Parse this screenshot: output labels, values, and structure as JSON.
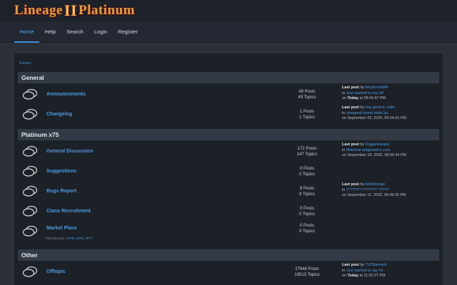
{
  "header": {
    "logo_left": "Lineage",
    "logo_mark": "II",
    "logo_right": "Platinum"
  },
  "nav": [
    "Home",
    "Help",
    "Search",
    "Login",
    "Register"
  ],
  "breadcrumb": "Forum",
  "categories": [
    {
      "title": "General",
      "boards": [
        {
          "title": "Announcements",
          "posts": "49 Posts",
          "topics": "49 Topics",
          "last_label": "Last post",
          "by": "by",
          "author": "AmyKnox884",
          "in": "in",
          "topic": "Just wanted to say Hi!",
          "on": "on",
          "date": "Today",
          "time": "at 08:42:47 PM"
        },
        {
          "title": "Changelog",
          "posts": "1 Posts",
          "topics": "1 Topics",
          "last_label": "Last post",
          "by": "by",
          "author": "buy generic cialis",
          "in": "in",
          "topic": "cheapest brand cialis 5p...",
          "on": "on",
          "date": "",
          "time": "September 02, 2020, 06:24:41 PM"
        }
      ]
    },
    {
      "title": "Platinum x75",
      "boards": [
        {
          "title": "General Discussion",
          "posts": "172 Posts",
          "topics": "147 Topics",
          "last_label": "Last post",
          "by": "by",
          "author": "Riggantsuqeq",
          "in": "in",
          "topic": "Maternal epigenetics com...",
          "on": "on",
          "date": "",
          "time": "September 18, 2020, 08:05:44 PM"
        },
        {
          "title": "Suggestions",
          "posts": "0 Posts",
          "topics": "0 Topics"
        },
        {
          "title": "Bugs Report",
          "posts": "9 Posts",
          "topics": "9 Topics",
          "last_label": "Last post",
          "by": "by",
          "author": "AdiSmonge",
          "in": "in",
          "topic": "??????? ??????? ?????",
          "on": "on",
          "date": "",
          "time": "September 11, 2020, 06:49:26 PM"
        },
        {
          "title": "Clans Recruitment",
          "posts": "0 Posts",
          "topics": "0 Topics"
        },
        {
          "title": "Market Place",
          "posts": "0 Posts",
          "topics": "0 Topics",
          "child_label": "Child Boards:",
          "children": "WTB, WTS, WTT"
        }
      ]
    },
    {
      "title": "Other",
      "boards": [
        {
          "title": "Offtopic",
          "posts": "27648 Posts",
          "topics": "19513 Topics",
          "last_label": "Last post",
          "by": "by",
          "author": "TZZNannieE",
          "in": "in",
          "topic": "Just wanted to say Hi.",
          "on": "on",
          "date": "Today",
          "time": "at 11:02:27 PM"
        }
      ]
    }
  ]
}
